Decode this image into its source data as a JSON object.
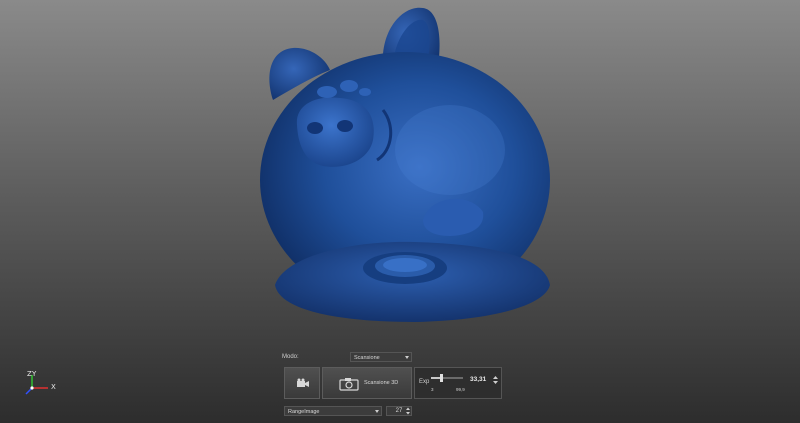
{
  "axis": {
    "x_label": "X",
    "y_label": "Y",
    "z_label": "Z",
    "colors": {
      "x": "#e03030",
      "y": "#30c030",
      "z": "#3050ff"
    }
  },
  "model": {
    "icon": "3d-scan-mesh",
    "color": "#1f4f9a"
  },
  "panel": {
    "mode_label": "Modo:",
    "mode_value": "Scansione",
    "camera_button_icon": "video-camera-icon",
    "scan_button_label": "Scansione 3D",
    "scan_button_icon": "camera-icon",
    "exp_label": "Exp",
    "exp_value": "33,31",
    "exp_min": "3",
    "exp_max": "99,9",
    "exp_slider_level": 0.33,
    "view_value": "RangeImage",
    "count_value": "27"
  }
}
